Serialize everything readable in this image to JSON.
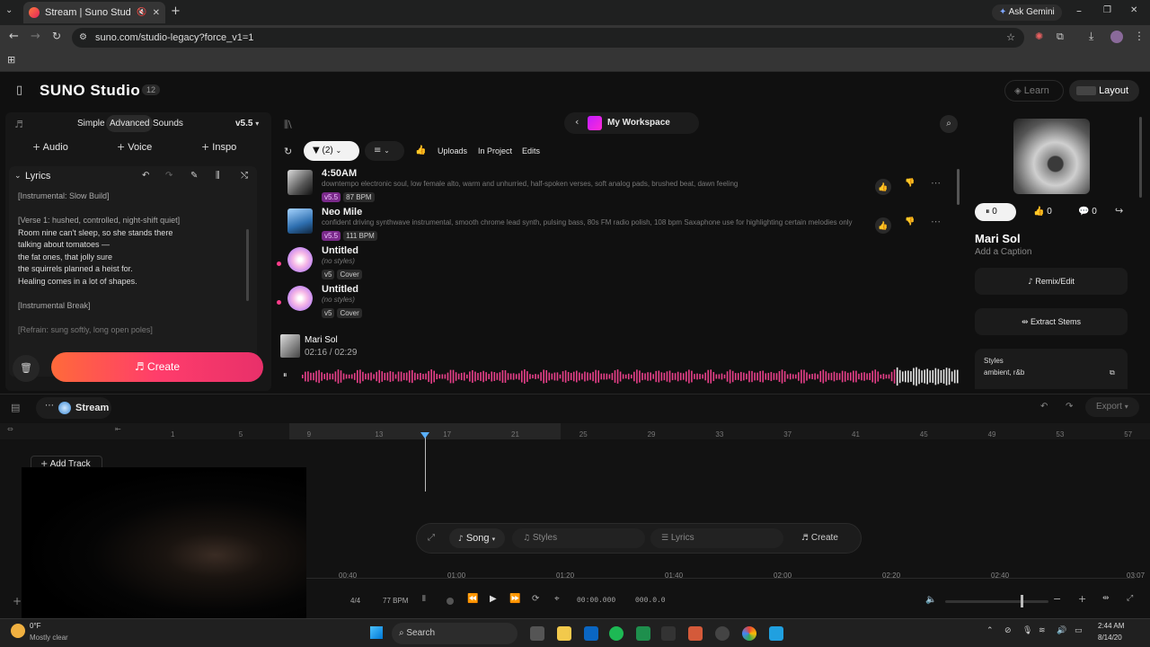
{
  "browser": {
    "tab_title": "Stream | Suno Studio",
    "url": "suno.com/studio-legacy?force_v1=1",
    "ask_gemini": "Ask Gemini"
  },
  "header": {
    "app_title": "SUNO Studio",
    "badge": "12",
    "learn": "Learn",
    "layout": "Layout"
  },
  "left_panel": {
    "modes": [
      "Simple",
      "Advanced",
      "Sounds"
    ],
    "version": "v5.5",
    "add_buttons": [
      "Audio",
      "Voice",
      "Inspo"
    ],
    "lyrics_label": "Lyrics",
    "lyrics_lines": [
      "[Instrumental: Slow Build]",
      "",
      "[Verse 1: hushed, controlled, night-shift quiet]",
      "Room nine can't sleep, so she stands there",
      "talking about tomatoes —",
      "the fat ones, that jolly sure",
      "the squirrels planned a heist for.",
      "Healing comes in a lot of shapes.",
      "",
      "[Instrumental Break]",
      "",
      "[Refrain: sung softly, long open poles]"
    ],
    "create": "Create"
  },
  "workspace": {
    "title": "My Workspace",
    "filter_count": "(2)",
    "filters": [
      "Uploads",
      "In Project",
      "Edits"
    ],
    "tracks": [
      {
        "title": "4:50AM",
        "desc": "downtempo electronic soul, low female alto, warm and unhurried, half-spoken verses, soft analog pads, brushed beat, dawn feeling",
        "tags": [
          "v5.5",
          "87 BPM"
        ]
      },
      {
        "title": "Neo Mile",
        "desc": "confident driving synthwave instrumental, smooth chrome lead synth, pulsing bass, 80s FM radio polish, 108 bpm Saxaphone use for highlighting certain melodies only",
        "tags": [
          "v5.5",
          "111 BPM"
        ]
      },
      {
        "title": "Untitled",
        "desc": "(no styles)",
        "tags": [
          "v5",
          "Cover"
        ]
      },
      {
        "title": "Untitled",
        "desc": "(no styles)",
        "tags": [
          "v5",
          "Cover"
        ]
      }
    ],
    "player_title": "Mari Sol",
    "player_time": "02:16 / 02:29",
    "progress": 0.9
  },
  "right_panel": {
    "play_count": "0",
    "like_count": "0",
    "comment_count": "0",
    "song_title": "Mari Sol",
    "caption": "Add a Caption",
    "remix": "Remix/Edit",
    "stems": "Extract Stems",
    "styles_label": "Styles",
    "styles_value": "ambient, r&b"
  },
  "timeline": {
    "stream_label": "Stream",
    "export": "Export",
    "add_track": "Add Track",
    "bar_numbers": [
      "1",
      "5",
      "9",
      "13",
      "17",
      "21",
      "25",
      "29",
      "33",
      "37",
      "41",
      "45",
      "49",
      "53",
      "57"
    ],
    "composer": {
      "song": "Song",
      "styles": "Styles",
      "lyrics": "Lyrics",
      "create": "Create"
    },
    "time_marks": [
      "00:40",
      "01:00",
      "01:20",
      "01:40",
      "02:00",
      "02:20",
      "02:40",
      "03:07"
    ],
    "time_sig": "4/4",
    "bpm": "77 BPM",
    "position": "00:00.000",
    "bars": "000.0.0"
  },
  "taskbar": {
    "weather_temp": "0°F",
    "weather": "Mostly clear",
    "search": "Search",
    "time": "2:44 AM",
    "date": "8/14/20"
  }
}
